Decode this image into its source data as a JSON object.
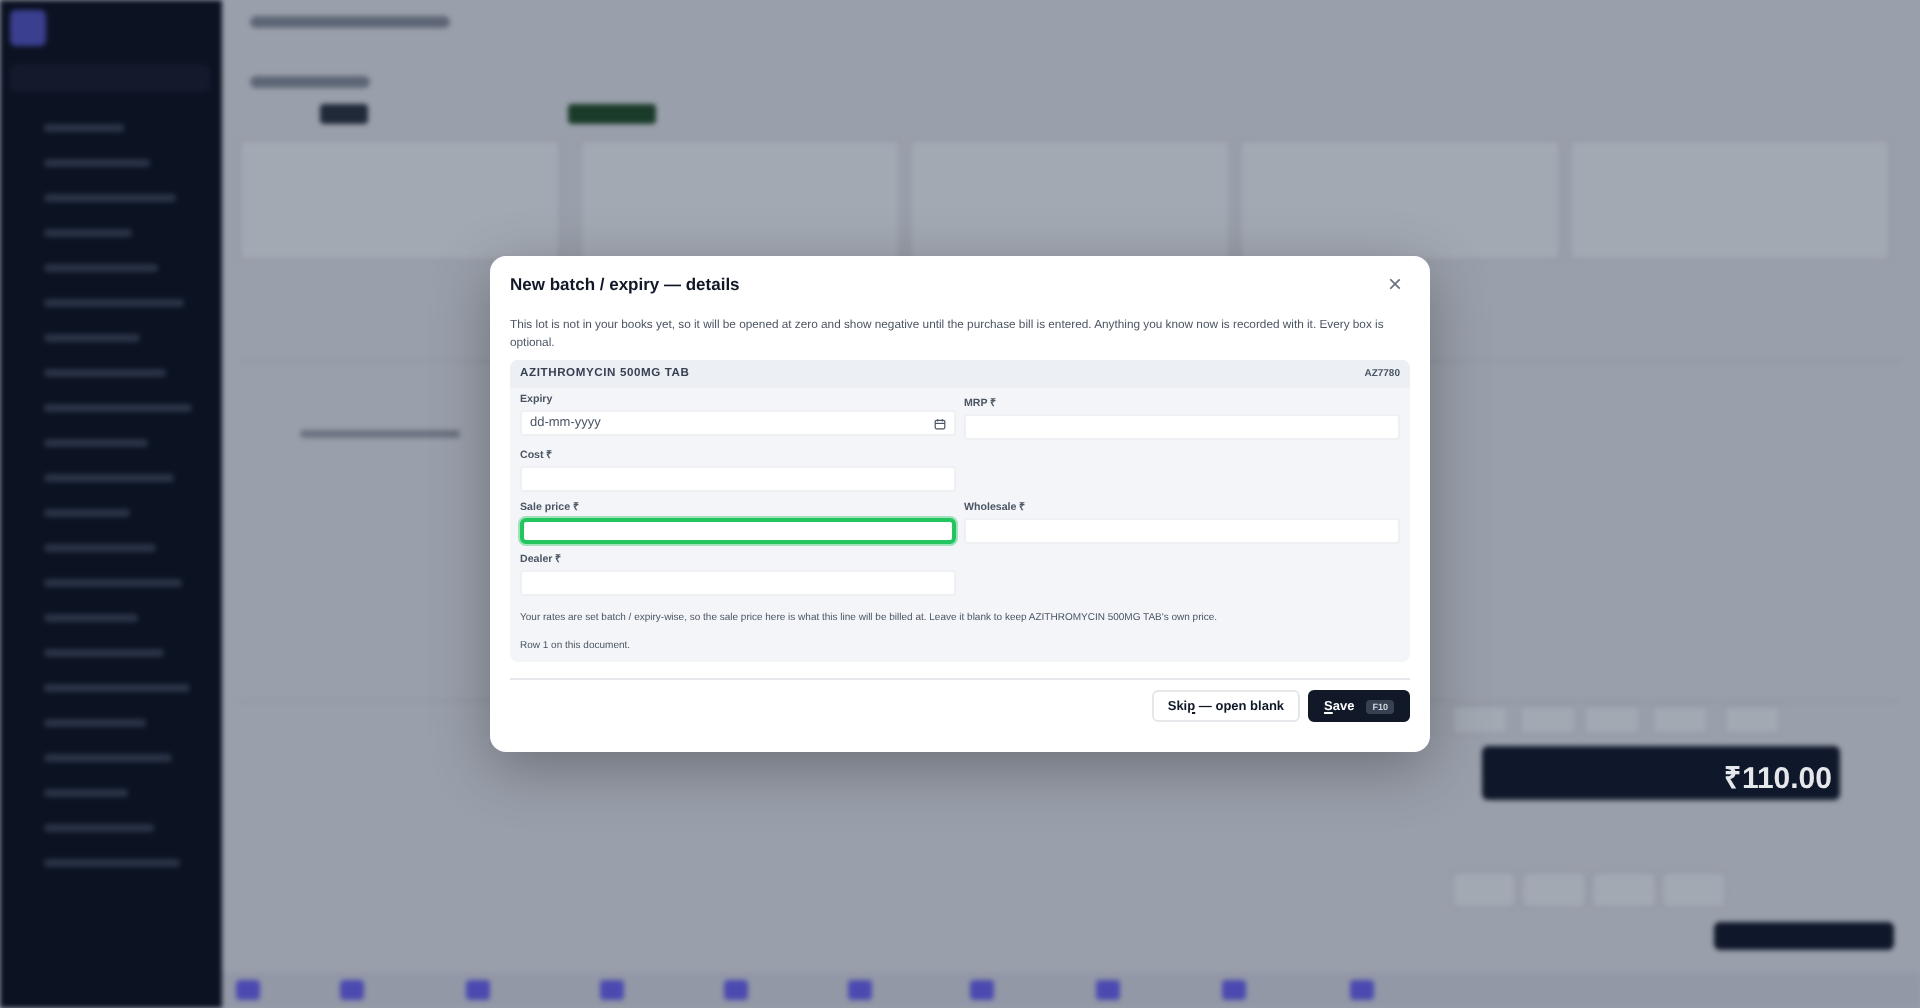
{
  "background": {
    "total": "₹110.00"
  },
  "dialog": {
    "title": "New batch / expiry — details",
    "close": "×",
    "description": "This lot is not in your books yet, so it will be opened at zero and show negative until the purchase bill is entered. Anything you know now is recorded with it. Every box is optional.",
    "item": {
      "name": "AZITHROMYCIN 500MG TAB",
      "code": "AZ7780"
    },
    "rows": [
      [
        {
          "label": "Expiry",
          "kind": "date",
          "placeholder": "dd-mm-yyyy",
          "focused": false
        },
        {
          "label": "MRP ₹",
          "kind": "text",
          "focused": false
        }
      ],
      [
        {
          "label": "Cost ₹",
          "kind": "text",
          "focused": false
        }
      ],
      [
        {
          "label": "Sale price ₹",
          "kind": "text",
          "focused": true
        },
        {
          "label": "Wholesale ₹",
          "kind": "text",
          "focused": false
        }
      ],
      [
        {
          "label": "Dealer ₹",
          "kind": "text",
          "focused": false
        }
      ]
    ],
    "note": "Your rates are set batch / expiry-wise, so the sale price here is what this line will be billed at. Leave it blank to keep AZITHROMYCIN 500MG TAB's own price.",
    "row_note": "Row 1 on this document.",
    "buttons": [
      {
        "before": "Ski",
        "key": "p",
        "after": " — open blank",
        "kind": "secondary"
      },
      {
        "key": "S",
        "after": "ave",
        "kind": "primary",
        "shortcut": "F10"
      }
    ]
  }
}
